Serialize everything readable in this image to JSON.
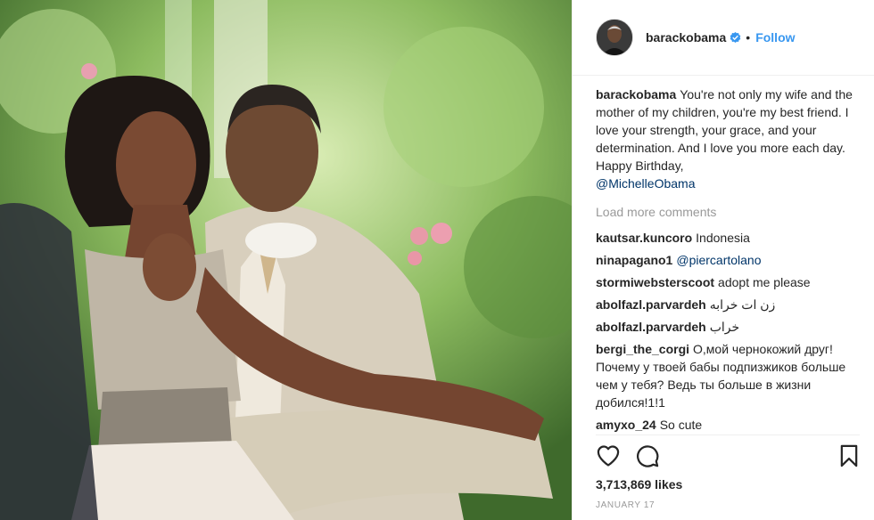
{
  "post": {
    "image_alt": "Barack and Michelle Obama sitting together outdoors",
    "author": "barackobama",
    "verified": true,
    "follow_label": "Follow",
    "separator": "•",
    "caption": {
      "user": "barackobama",
      "text": "You're not only my wife and the mother of my children, you're my best friend. I love your strength, your grace, and your determination. And I love you more each day. Happy Birthday,",
      "mention": "@MichelleObama"
    },
    "load_more": "Load more comments",
    "comments": [
      {
        "user": "kautsar.kuncoro",
        "text": "Indonesia"
      },
      {
        "user": "ninapagano1",
        "text": "@piercartolano"
      },
      {
        "user": "stormiwebsterscoot",
        "text": "adopt me please"
      },
      {
        "user": "abolfazl.parvardeh",
        "text": "زن ات خرابه"
      },
      {
        "user": "abolfazl.parvardeh",
        "text": "خراب"
      },
      {
        "user": "bergi_the_corgi",
        "text": "О,мой чернокожий друг! Почему у твоей бабы подпизжиков больше чем у тебя? Ведь ты больше в жизни добился!1!1"
      },
      {
        "user": "amyxo_24",
        "text": "So cute"
      }
    ],
    "likes": "3,713,869 likes",
    "date": "JANUARY 17",
    "icons": {
      "like": "heart-icon",
      "comment": "speech-bubble-icon",
      "save": "bookmark-icon",
      "verified": "verified-badge-icon"
    },
    "colors": {
      "link": "#3897f0",
      "mention": "#003569",
      "muted": "#999999",
      "text": "#262626"
    }
  }
}
